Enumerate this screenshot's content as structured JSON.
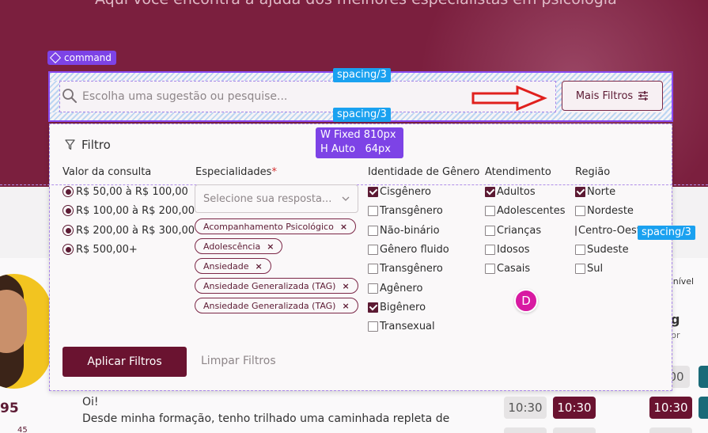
{
  "hero": {
    "subtitle": "Aqui você encontra a ajuda dos melhores especialistas em psicologia"
  },
  "command": {
    "tag_label": "command",
    "search": {
      "placeholder": "Escolha uma sugestão ou pesquise...",
      "value": ""
    },
    "more_filters_label": "Mais Filtros"
  },
  "annotations": {
    "spacing_label": "spacing/3",
    "width_label": "W Fixed 810px",
    "height_label": "H Auto   64px"
  },
  "filter": {
    "title": "Filtro",
    "price": {
      "label": "Valor da consulta",
      "options": [
        "R$ 50,00 à R$ 100,00",
        "R$ 100,00 à R$ 200,00",
        "R$ 200,00 à R$ 300,00",
        "R$ 500,00+"
      ]
    },
    "specialties": {
      "label": "Especialidades",
      "required_mark": "*",
      "placeholder": "Selecione sua resposta...",
      "chips": [
        "Acompanhamento Psicológico",
        "Adolescência",
        "Ansiedade",
        "Ansiedade Generalizada (TAG)",
        "Ansiedade Generalizada (TAG)"
      ],
      "remove_glyph": "×"
    },
    "gender": {
      "label": "Identidade de Gênero",
      "options": [
        {
          "label": "Cisgênero",
          "checked": true
        },
        {
          "label": "Transgênero",
          "checked": false
        },
        {
          "label": "Não-binário",
          "checked": false
        },
        {
          "label": "Gênero fluido",
          "checked": false
        },
        {
          "label": "Transgênero",
          "checked": false
        },
        {
          "label": "Agênero",
          "checked": false
        },
        {
          "label": "Bigênero",
          "checked": true
        },
        {
          "label": "Transexual",
          "checked": false
        }
      ]
    },
    "care": {
      "label": "Atendimento",
      "options": [
        {
          "label": "Adultos",
          "checked": true
        },
        {
          "label": "Adolescentes",
          "checked": false
        },
        {
          "label": "Crianças",
          "checked": false
        },
        {
          "label": "Idosos",
          "checked": false
        },
        {
          "label": "Casais",
          "checked": false
        }
      ]
    },
    "region": {
      "label": "Região",
      "options": [
        {
          "label": "Norte",
          "checked": true
        },
        {
          "label": "Nordeste",
          "checked": false
        },
        {
          "label": "Centro-Oeste",
          "checked": false
        },
        {
          "label": "Sudeste",
          "checked": false
        },
        {
          "label": "Sul",
          "checked": false
        }
      ]
    },
    "apply_label": "Aplicar Filtros",
    "clear_label": "Limpar Filtros"
  },
  "presence_avatar": "D",
  "background_card": {
    "rating": "95",
    "reviews": "45",
    "bio_lines": [
      "Oi!",
      "Desde minha formação, tenho trilhado uma caminhada repleta de"
    ],
    "availability_label": "onível",
    "right_name": "g",
    "right_sub": "br",
    "slots": [
      "00",
      "10:30",
      "10:30",
      "10:30"
    ]
  },
  "colors": {
    "brand": "#6a1330",
    "hero": "#7b1f3e",
    "annotation_purple": "#7d43e6",
    "annotation_blue": "#1aa1f0"
  }
}
